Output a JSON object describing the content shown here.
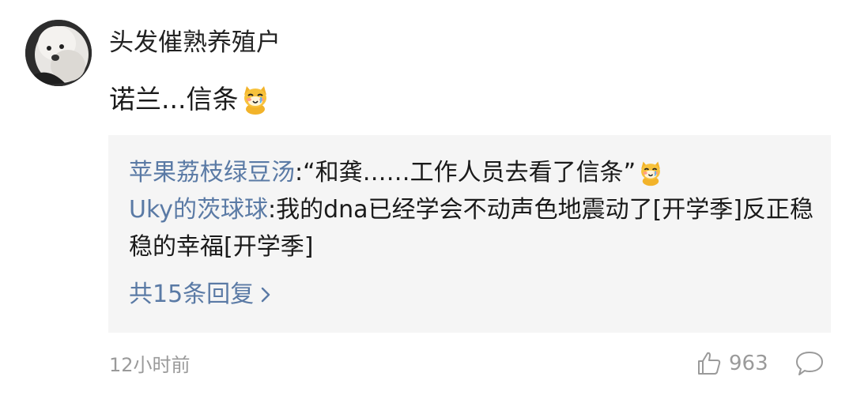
{
  "comment": {
    "username": "头发催熟养殖户",
    "content_text": "诺兰...信条",
    "content_emoji": "cat-emoji",
    "timestamp": "12小时前",
    "like_count": "963",
    "avatar": "avatar-photo"
  },
  "replies": [
    {
      "name": "苹果荔枝绿豆汤",
      "colon": ":",
      "text": "“和龚……工作人员去看了信条”",
      "emoji": "cat-emoji"
    },
    {
      "name": "Uky的茨球球",
      "colon": ":",
      "text": "我的dna已经学会不动声色地震动了[开学季]反正稳稳的幸福[开学季]"
    }
  ],
  "more_replies_label": "共15条回复",
  "icons": {
    "like": "thumbs-up-icon",
    "comment": "comment-bubble-icon",
    "more": "chevron-right-icon"
  },
  "colors": {
    "link_blue": "#5a7aa5",
    "reply_bg": "#f5f5f5",
    "meta_gray": "#9a9a9a"
  }
}
